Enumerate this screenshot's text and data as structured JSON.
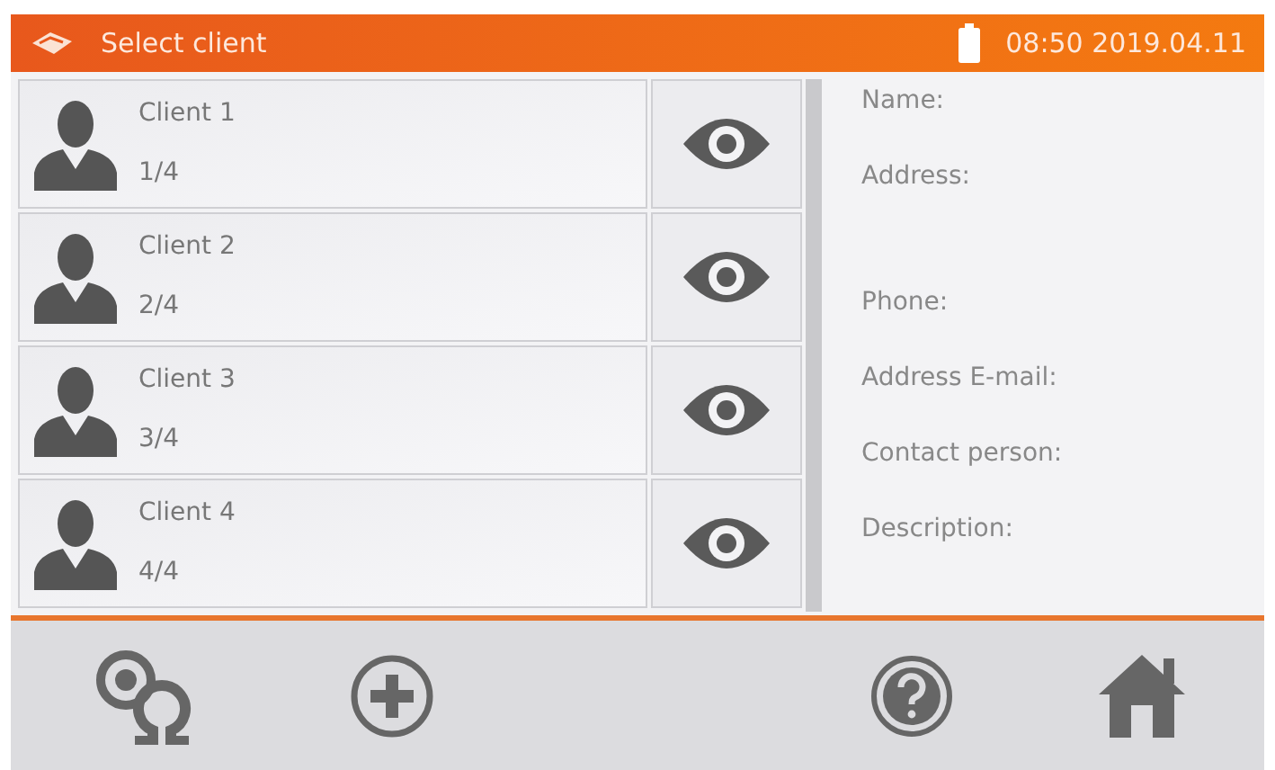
{
  "header": {
    "title": "Select client",
    "datetime": "08:50 2019.04.11"
  },
  "clients": [
    {
      "name": "Client 1",
      "position": "1/4"
    },
    {
      "name": "Client 2",
      "position": "2/4"
    },
    {
      "name": "Client 3",
      "position": "3/4"
    },
    {
      "name": "Client 4",
      "position": "4/4"
    }
  ],
  "details": [
    "Name:",
    "Address:",
    "Phone:",
    "Address E-mail:",
    "Contact person:",
    "Description:"
  ]
}
